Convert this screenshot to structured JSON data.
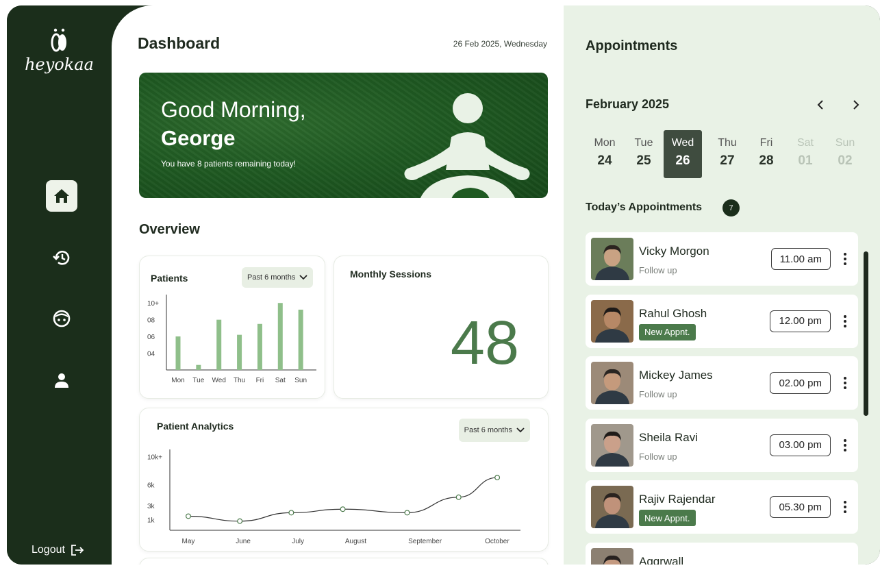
{
  "brand": {
    "logo_text": "heyokaa"
  },
  "sidebar": {
    "items": [
      {
        "name": "home",
        "icon": "home-icon",
        "active": true
      },
      {
        "name": "history",
        "icon": "history-icon",
        "active": false
      },
      {
        "name": "mood",
        "icon": "face-icon",
        "active": false
      },
      {
        "name": "profile",
        "icon": "user-icon",
        "active": false
      }
    ],
    "logout_label": "Logout"
  },
  "header": {
    "title": "Dashboard",
    "date": "26 Feb 2025, Wednesday"
  },
  "hero": {
    "greeting": "Good Morning,",
    "name": "George",
    "subtitle": "You have 8 patients remaining today!"
  },
  "overview": {
    "title": "Overview",
    "patients_card": {
      "title": "Patients",
      "filter": "Past 6 months"
    },
    "sessions_card": {
      "title": "Monthly Sessions",
      "value": "48"
    },
    "analytics_card": {
      "title": "Patient Analytics",
      "filter": "Past 6 months"
    }
  },
  "chart_data": [
    {
      "type": "bar",
      "categories": [
        "Mon",
        "Tue",
        "Wed",
        "Thu",
        "Fri",
        "Sat",
        "Sun"
      ],
      "values": [
        6,
        2.6,
        8,
        6.2,
        7.5,
        10,
        9.2
      ],
      "ytick_labels": [
        "04",
        "06",
        "08",
        "10+"
      ],
      "ytick_values": [
        4,
        6,
        8,
        10
      ],
      "ylim": [
        2,
        11
      ],
      "color": "#8fbf8a"
    },
    {
      "type": "line",
      "categories": [
        "May",
        "June",
        "July",
        "August",
        "September",
        "October"
      ],
      "x": [
        0,
        0.8,
        1.6,
        2.4,
        3.4,
        4.2,
        4.8
      ],
      "values": [
        1.5,
        0.8,
        2.0,
        2.5,
        2.0,
        4.2,
        7.0
      ],
      "ytick_labels": [
        "1k",
        "3k",
        "6k",
        "10k+"
      ],
      "ytick_values": [
        1,
        3,
        6,
        10
      ],
      "ylim": [
        -0.5,
        11
      ],
      "color": "#333333"
    }
  ],
  "appointments": {
    "title": "Appointments",
    "month": "February 2025",
    "days": [
      {
        "name": "Mon",
        "num": "24",
        "state": "normal"
      },
      {
        "name": "Tue",
        "num": "25",
        "state": "normal"
      },
      {
        "name": "Wed",
        "num": "26",
        "state": "selected"
      },
      {
        "name": "Thu",
        "num": "27",
        "state": "normal"
      },
      {
        "name": "Fri",
        "num": "28",
        "state": "normal"
      },
      {
        "name": "Sat",
        "num": "01",
        "state": "muted"
      },
      {
        "name": "Sun",
        "num": "02",
        "state": "muted"
      }
    ],
    "today_title": "Today’s Appointments",
    "today_count": "7",
    "items": [
      {
        "name": "Vicky Morgon",
        "tag": "Follow up",
        "is_new": false,
        "time": "11.00 am"
      },
      {
        "name": "Rahul Ghosh",
        "tag": "New Appnt.",
        "is_new": true,
        "time": "12.00 pm"
      },
      {
        "name": "Mickey James",
        "tag": "Follow up",
        "is_new": false,
        "time": "02.00 pm"
      },
      {
        "name": "Sheila Ravi",
        "tag": "Follow up",
        "is_new": false,
        "time": "03.00 pm"
      },
      {
        "name": "Rajiv Rajendar",
        "tag": "New Appnt.",
        "is_new": true,
        "time": "05.30 pm"
      },
      {
        "name": "Aggrwall",
        "tag": "",
        "is_new": false,
        "time": ""
      }
    ]
  },
  "colors": {
    "sidebar_bg": "#1b2e1b",
    "accent_green": "#4b7a4b",
    "bar_green": "#8fbf8a",
    "panel_bg": "#e9f2e6"
  }
}
